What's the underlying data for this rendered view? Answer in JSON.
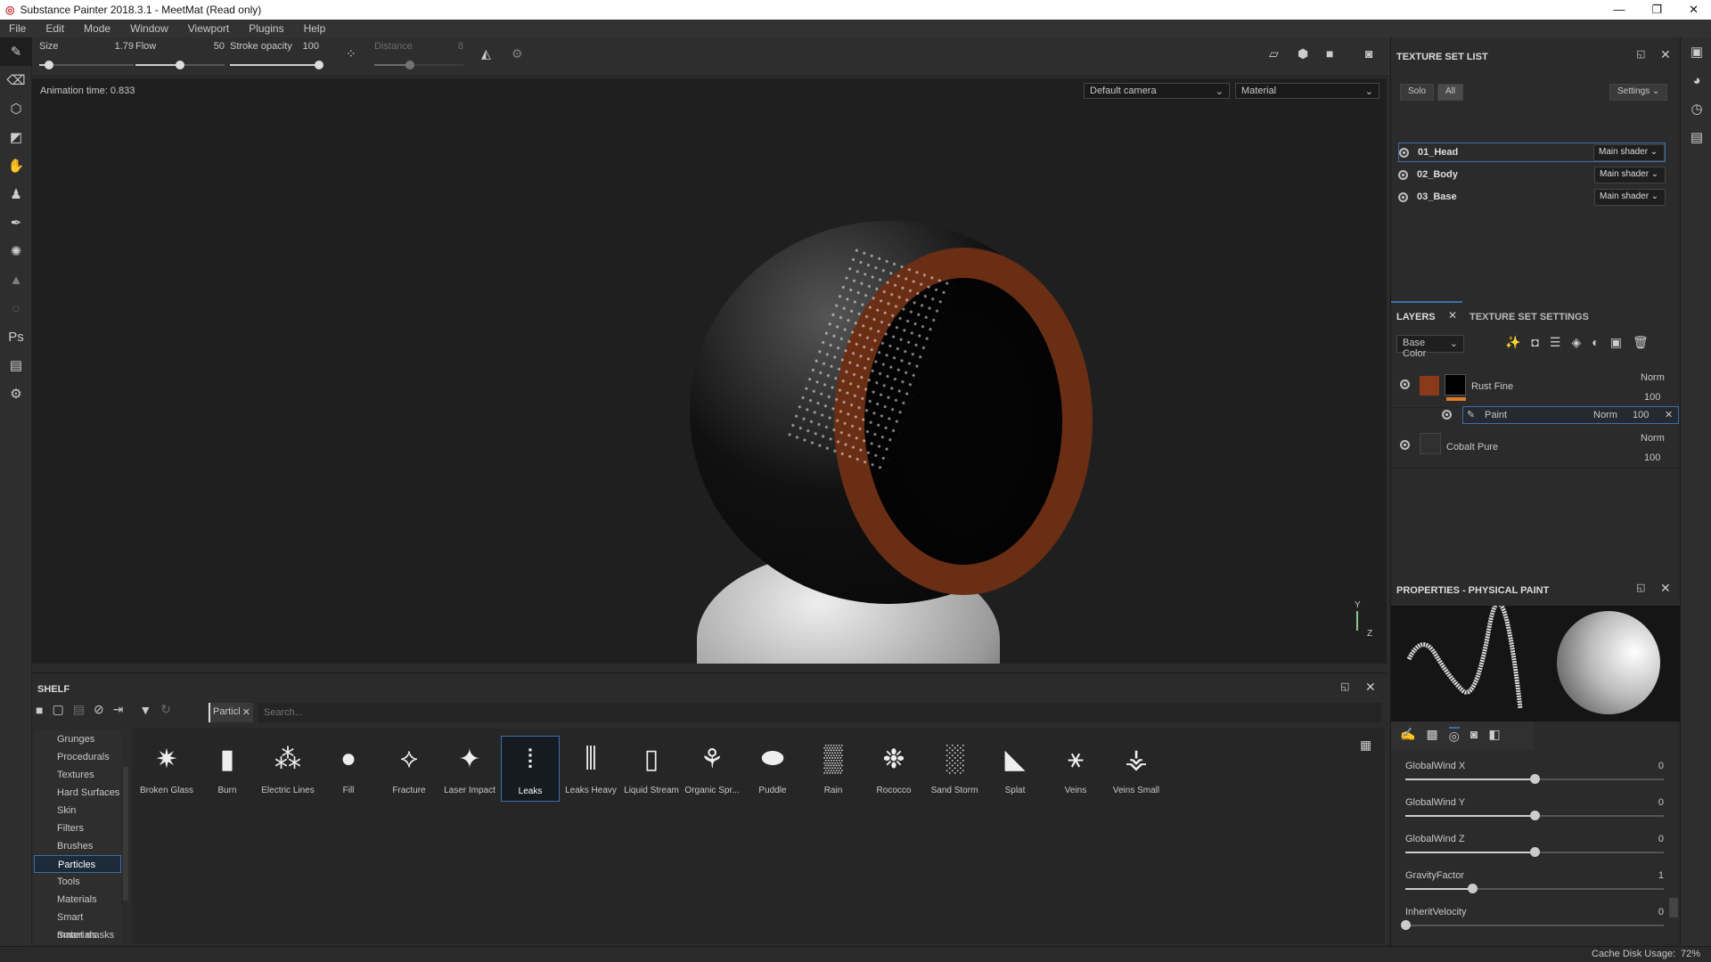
{
  "window": {
    "title": "Substance Painter 2018.3.1 - MeetMat (Read only)",
    "controls": [
      "—",
      "❐",
      "✕"
    ]
  },
  "menu": [
    "File",
    "Edit",
    "Mode",
    "Window",
    "Viewport",
    "Plugins",
    "Help"
  ],
  "tool_options": {
    "size": {
      "label": "Size",
      "value": "1.79",
      "fraction": 0.1
    },
    "flow": {
      "label": "Flow",
      "value": "50",
      "fraction": 0.5
    },
    "stroke_opacity": {
      "label": "Stroke opacity",
      "value": "100",
      "fraction": 1.0
    },
    "distance": {
      "label": "Distance",
      "value": "8",
      "fraction": 0.4
    }
  },
  "viewport": {
    "animation_time": "Animation time: 0.833",
    "camera": "Default camera",
    "mode": "Material",
    "axis_y": "Y",
    "axis_z": "Z"
  },
  "texture_set_list": {
    "title": "TEXTURE SET LIST",
    "solo": "Solo",
    "all": "All",
    "settings": "Settings",
    "items": [
      {
        "name": "01_Head",
        "shader": "Main shader"
      },
      {
        "name": "02_Body",
        "shader": "Main shader"
      },
      {
        "name": "03_Base",
        "shader": "Main shader"
      }
    ]
  },
  "layers": {
    "tab_layers": "LAYERS",
    "tab_settings": "TEXTURE SET SETTINGS",
    "channel": "Base Color",
    "items": [
      {
        "name": "Rust Fine",
        "blend": "Norm",
        "opacity": "100"
      },
      {
        "name": "Paint",
        "blend": "Norm",
        "opacity": "100"
      },
      {
        "name": "Cobalt Pure",
        "blend": "Norm",
        "opacity": "100"
      }
    ]
  },
  "properties": {
    "title": "PROPERTIES - PHYSICAL PAINT",
    "params": [
      {
        "label": "GlobalWind X",
        "value": "0",
        "fraction": 0.5
      },
      {
        "label": "GlobalWind Y",
        "value": "0",
        "fraction": 0.5
      },
      {
        "label": "GlobalWind Z",
        "value": "0",
        "fraction": 0.5
      },
      {
        "label": "GravityFactor",
        "value": "1",
        "fraction": 0.26
      },
      {
        "label": "InheritVelocity",
        "value": "0",
        "fraction": 0.0
      }
    ]
  },
  "shelf": {
    "title": "SHELF",
    "filter_tag": "Particles",
    "search_placeholder": "Search...",
    "categories": [
      "Grunges",
      "Procedurals",
      "Textures",
      "Hard Surfaces",
      "Skin",
      "Filters",
      "Brushes",
      "Particles",
      "Tools",
      "Materials",
      "Smart materials",
      "Smart masks"
    ],
    "active_category": "Particles",
    "items": [
      "Broken Glass",
      "Burn",
      "Electric Lines",
      "Fill",
      "Fracture",
      "Laser Impact",
      "Leaks",
      "Leaks Heavy",
      "Liquid Stream",
      "Organic Spr...",
      "Puddle",
      "Rain",
      "Rococco",
      "Sand Storm",
      "Splat",
      "Veins",
      "Veins Small"
    ],
    "active_item": "Leaks"
  },
  "status": {
    "cache_label": "Cache Disk Usage:",
    "cache_value": "72%"
  },
  "colors": {
    "accent": "#3d6ea8",
    "rust": "#8a3a1a",
    "orange_bar": "#e07a2a"
  }
}
